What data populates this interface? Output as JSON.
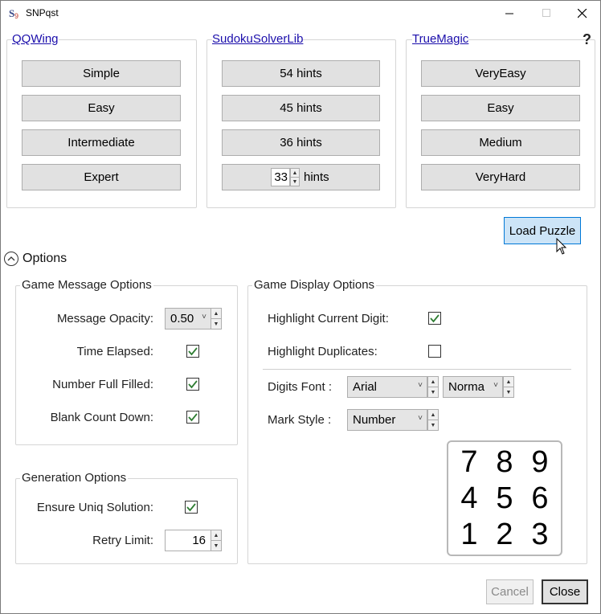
{
  "window": {
    "title": "SNPqst",
    "app_icon": "sudoku-app-icon"
  },
  "generators": [
    {
      "name": "QQWing",
      "buttons": [
        "Simple",
        "Easy",
        "Intermediate",
        "Expert"
      ]
    },
    {
      "name": "SudokuSolverLib",
      "buttons": [
        "54 hints",
        "45 hints",
        "36 hints"
      ],
      "custom_value": "33",
      "custom_suffix": "hints"
    },
    {
      "name": "TrueMagic",
      "buttons": [
        "VeryEasy",
        "Easy",
        "Medium",
        "VeryHard"
      ]
    }
  ],
  "help_label": "?",
  "load_button": "Load Puzzle",
  "options": {
    "label": "Options",
    "expanded": true
  },
  "game_message": {
    "title": "Game Message Options",
    "opacity_label": "Message Opacity:",
    "opacity_value": "0.50",
    "time_elapsed_label": "Time Elapsed:",
    "time_elapsed_checked": true,
    "number_full_label": "Number Full Filled:",
    "number_full_checked": true,
    "blank_count_label": "Blank Count Down:",
    "blank_count_checked": true
  },
  "generation": {
    "title": "Generation Options",
    "ensure_label": "Ensure Uniq Solution:",
    "ensure_checked": true,
    "retry_label": "Retry Limit:",
    "retry_value": "16"
  },
  "display": {
    "title": "Game Display Options",
    "highlight_digit_label": "Highlight Current Digit:",
    "highlight_digit_checked": true,
    "highlight_dup_label": "Highlight Duplicates:",
    "highlight_dup_checked": false,
    "digits_font_label": "Digits Font :",
    "font_family_value": "Arial",
    "font_weight_value": "Norma",
    "mark_style_label": "Mark Style :",
    "mark_style_value": "Number",
    "preview_digits": [
      "7",
      "8",
      "9",
      "4",
      "5",
      "6",
      "1",
      "2",
      "3"
    ]
  },
  "dialog": {
    "cancel": "Cancel",
    "close": "Close"
  },
  "colors": {
    "accent": "#0078d7",
    "link": "#1a0dab",
    "check": "#2e7d32"
  }
}
